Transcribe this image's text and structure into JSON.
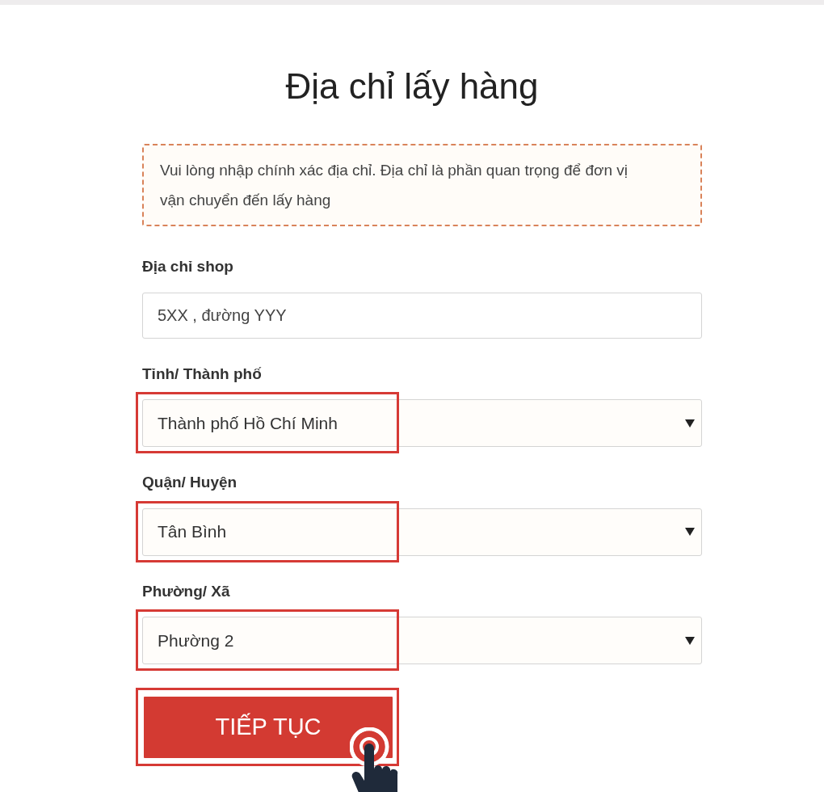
{
  "title": "Địa chỉ lấy hàng",
  "notice": "Vui lòng nhập chính xác địa chỉ. Địa chỉ là phần quan trọng để đơn vị vận chuyển đến lấy hàng",
  "fields": [
    {
      "kind": "input",
      "label": "Địa chỉ shop",
      "value": "5XX , đường YYY",
      "highlighted": false
    },
    {
      "kind": "select",
      "label": "Tỉnh/ Thành phố",
      "value": "Thành phố Hồ Chí Minh",
      "highlighted": true
    },
    {
      "kind": "select",
      "label": "Quận/ Huyện",
      "value": "Tân Bình",
      "highlighted": true
    },
    {
      "kind": "select",
      "label": "Phường/ Xã",
      "value": "Phường 2",
      "highlighted": true
    }
  ],
  "button": {
    "label": "TIẾP TỤC",
    "highlighted": true,
    "tapped": true
  }
}
